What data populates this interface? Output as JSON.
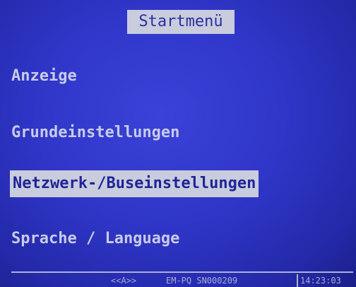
{
  "screen": {
    "title": "Startmenü"
  },
  "menu": {
    "items": [
      {
        "label": "Anzeige"
      },
      {
        "label": "Grundeinstellungen"
      },
      {
        "label": "Netzwerk-/Buseinstellungen",
        "selected": true
      },
      {
        "label": "Sprache / Language"
      }
    ]
  },
  "status_bar": {
    "nav": "<<A>>",
    "device": "EM-PQ SN000209",
    "time": "14:23:03"
  },
  "colors": {
    "background": "#2f36c8",
    "highlight": "#c9ccdd",
    "text": "#c8cbe6"
  }
}
